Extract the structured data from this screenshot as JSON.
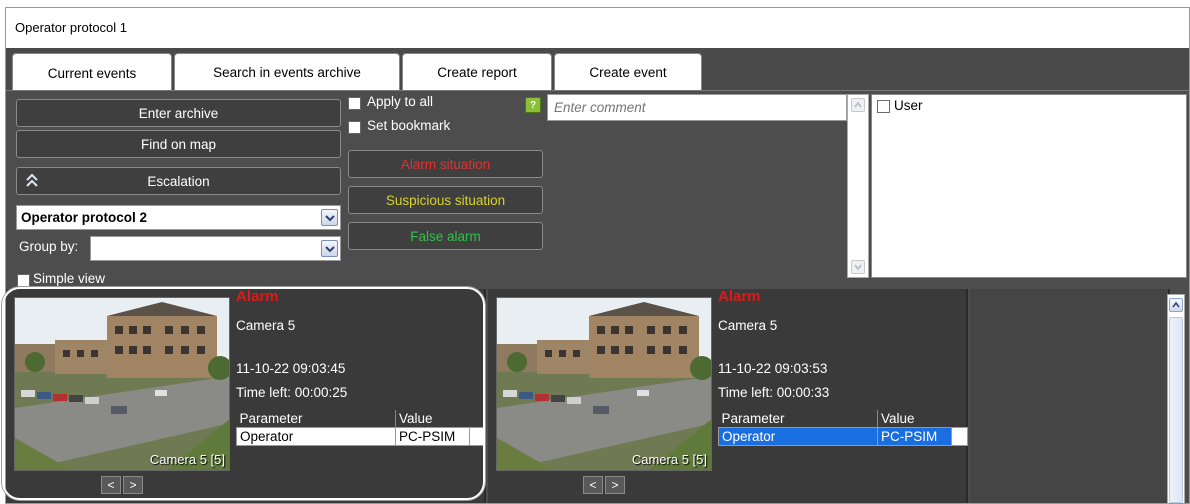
{
  "window": {
    "title": "Operator protocol 1"
  },
  "tabs": [
    {
      "label": "Current events",
      "active": true
    },
    {
      "label": "Search in events archive",
      "active": false
    },
    {
      "label": "Create report",
      "active": false
    },
    {
      "label": "Create event",
      "active": false
    }
  ],
  "controls": {
    "enter_archive": "Enter archive",
    "find_on_map": "Find on map",
    "escalation": "Escalation",
    "protocol_select_value": "Operator protocol 2",
    "group_by_label": "Group by:",
    "group_by_value": "",
    "simple_view": "Simple view",
    "apply_to_all": "Apply to all",
    "set_bookmark": "Set bookmark",
    "help_mark": "?",
    "comment_placeholder": "Enter comment",
    "alarm_situation": "Alarm situation",
    "suspicious_situation": "Suspicious situation",
    "false_alarm": "False alarm",
    "user_label": "User"
  },
  "colors": {
    "alarm_red": "#e53030",
    "suspicious_yellow": "#d9d229",
    "false_green": "#33c04a",
    "panel_bg": "#4d4d4d",
    "selection_blue": "#1a6fe0"
  },
  "events": [
    {
      "status": "Alarm",
      "camera": "Camera 5",
      "datetime": "11-10-22 09:03:45",
      "time_left": "Time left: 00:00:25",
      "image_caption": "Camera 5 [5]",
      "table_headers": [
        "Parameter",
        "Value"
      ],
      "rows": [
        {
          "parameter": "Operator",
          "value": "PC-PSIM"
        }
      ],
      "prev": "<",
      "next": ">"
    },
    {
      "status": "Alarm",
      "camera": "Camera 5",
      "datetime": "11-10-22 09:03:53",
      "time_left": "Time left: 00:00:33",
      "image_caption": "Camera 5 [5]",
      "table_headers": [
        "Parameter",
        "Value"
      ],
      "rows": [
        {
          "parameter": "Operator",
          "value": "PC-PSIM"
        }
      ],
      "prev": "<",
      "next": ">"
    }
  ]
}
